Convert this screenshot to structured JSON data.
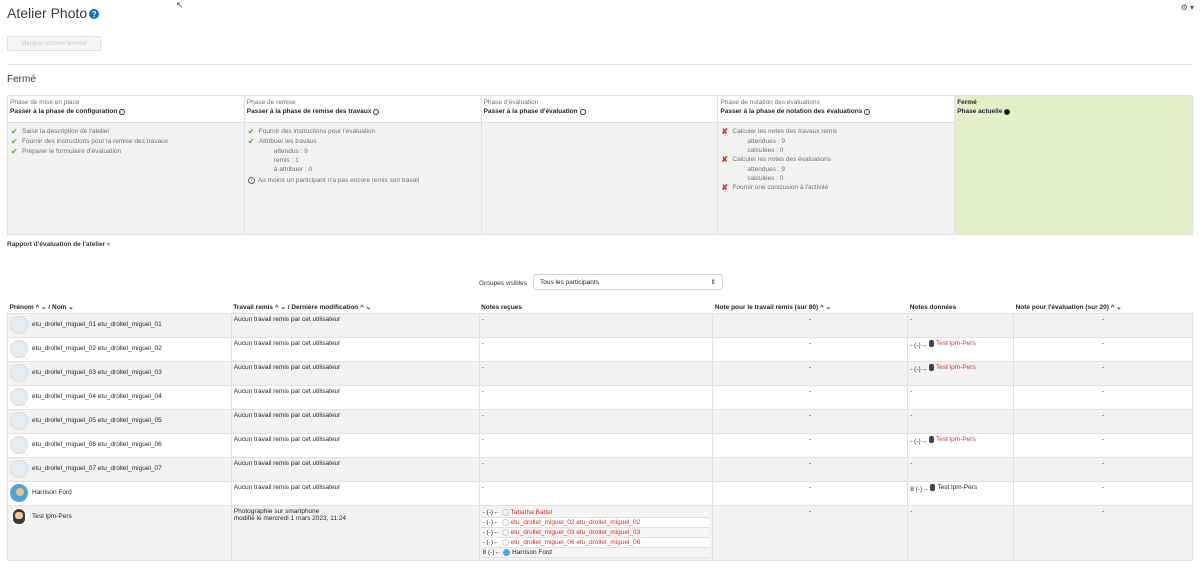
{
  "header": {
    "title": "Atelier Photo",
    "help_label": "?",
    "gear_label": "⚙ ▾",
    "mark_button_label": "Marquer comme terminé"
  },
  "state_title": "Fermé",
  "phases": [
    {
      "name": "Phase de mise en place",
      "switch_label": "Passer à la phase de configuration",
      "tasks": [
        {
          "status": "done",
          "label": "Saisir la description de l'atelier"
        },
        {
          "status": "done",
          "label": "Fournir des instructions pour la remise des travaux"
        },
        {
          "status": "done",
          "label": "Préparer le formulaire d'évaluation"
        }
      ]
    },
    {
      "name": "Phase de remise",
      "switch_label": "Passer à la phase de remise des travaux",
      "tasks": [
        {
          "status": "done",
          "label": "Fournir des instructions pour l'évaluation"
        },
        {
          "status": "done",
          "label": "Attribuer les travaux"
        }
      ],
      "details": [
        "attendus : 9",
        "remis : 1",
        "à attribuer : 0"
      ],
      "info": "Au moins un participant n'a pas encore remis son travail"
    },
    {
      "name": "Phase d'évaluation",
      "switch_label": "Passer à la phase d'évaluation"
    },
    {
      "name": "Phase de notation des évaluations",
      "switch_label": "Passer à la phase de notation des évaluations",
      "task1": "Calculer les notes des travaux remis",
      "task1_details": [
        "attendues : 9",
        "calculées : 0"
      ],
      "task2": "Calculer les notes des évaluations",
      "task2_details": [
        "attendues : 9",
        "calculées : 0"
      ],
      "task3": "Fournir une conclusion à l'activité"
    },
    {
      "name": "Fermé",
      "switch_label": "Phase actuelle"
    }
  ],
  "report_toggle": "Rapport d'évaluation de l'atelier",
  "groups": {
    "label": "Groupes visibles",
    "selected": "Tous les participants"
  },
  "table": {
    "headers": {
      "firstname": "Prénom",
      "lastname": "/ Nom",
      "submission": "Travail remis",
      "lastmodified": "/ Dernière modification",
      "received": "Notes reçues",
      "subgrade": "Note pour le travail remis (sur 80)",
      "given": "Notes données",
      "assessgrade": "Note pour l'évaluation (sur 20)"
    },
    "sort_up": "^",
    "sort_down": "⌄",
    "dash": "-",
    "rows": [
      {
        "name": "etu_drollet_miguel_01 etu_drollet_miguel_01",
        "submission": "Aucun travail remis par cet utilisateur",
        "received": "-",
        "subgrade": "-",
        "given_prefix": "-",
        "given_name": "",
        "assessgrade": "-"
      },
      {
        "name": "etu_drollet_miguel_02 etu_drollet_miguel_02",
        "submission": "Aucun travail remis par cet utilisateur",
        "received": "-",
        "subgrade": "-",
        "given_prefix": "- (-)→",
        "given_name": "Test lpm-Pers",
        "assessgrade": "-"
      },
      {
        "name": "etu_drollet_miguel_03 etu_drollet_miguel_03",
        "submission": "Aucun travail remis par cet utilisateur",
        "received": "-",
        "subgrade": "-",
        "given_prefix": "- (-)→",
        "given_name": "Test lpm-Pers",
        "assessgrade": "-"
      },
      {
        "name": "etu_drollet_miguel_04 etu_drollet_miguel_04",
        "submission": "Aucun travail remis par cet utilisateur",
        "received": "-",
        "subgrade": "-",
        "given_prefix": "-",
        "given_name": "",
        "assessgrade": "-"
      },
      {
        "name": "etu_drollet_miguel_05 etu_drollet_miguel_05",
        "submission": "Aucun travail remis par cet utilisateur",
        "received": "-",
        "subgrade": "-",
        "given_prefix": "-",
        "given_name": "",
        "assessgrade": "-"
      },
      {
        "name": "etu_drollet_miguel_06 etu_drollet_miguel_06",
        "submission": "Aucun travail remis par cet utilisateur",
        "received": "-",
        "subgrade": "-",
        "given_prefix": "- (-)→",
        "given_name": "Test lpm-Pers",
        "assessgrade": "-"
      },
      {
        "name": "etu_drollet_miguel_07 etu_drollet_miguel_07",
        "submission": "Aucun travail remis par cet utilisateur",
        "received": "-",
        "subgrade": "-",
        "given_prefix": "-",
        "given_name": "",
        "assessgrade": "-"
      },
      {
        "name": "Harrison Ford",
        "submission": "Aucun travail remis par cet utilisateur",
        "received": "-",
        "subgrade": "-",
        "given_prefix": "8 (-)→",
        "given_name": "Test lpm-Pers",
        "assessgrade": "-"
      }
    ],
    "test_row": {
      "name": "Test lpm-Pers",
      "submission_title": "Photographie sur smartphone",
      "submission_modified": "modifié le mercredi 1 mars 2023, 11:24",
      "received": [
        {
          "prefix": "- (-)←",
          "name": "Tabatha Battel"
        },
        {
          "prefix": "- (-)←",
          "name": "etu_drollet_miguel_02 etu_drollet_miguel_02"
        },
        {
          "prefix": "- (-)←",
          "name": "etu_drollet_miguel_03 etu_drollet_miguel_03"
        },
        {
          "prefix": "- (-)←",
          "name": "etu_drollet_miguel_06 etu_drollet_miguel_06"
        },
        {
          "prefix": "8 (-)←",
          "name": "Harrison Ford"
        }
      ],
      "subgrade": "-",
      "given": "-",
      "assessgrade": "-"
    }
  }
}
